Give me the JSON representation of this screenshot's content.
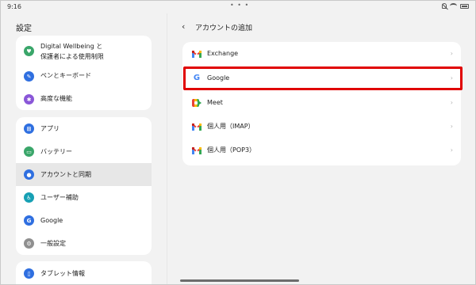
{
  "status_bar": {
    "time": "9:16",
    "center_dots": "• • •"
  },
  "left_pane": {
    "title": "設定",
    "card1": [
      {
        "label": "Digital Wellbeing と\n保護者による使用制限",
        "icon": "wellbeing-icon",
        "color": "#3aa66a"
      },
      {
        "label": "ペンとキーボード",
        "icon": "pen-icon",
        "color": "#2f6fe0"
      },
      {
        "label": "高度な機能",
        "icon": "advanced-icon",
        "color": "#8a57d8"
      }
    ],
    "card2": [
      {
        "label": "アプリ",
        "icon": "apps-icon",
        "color": "#2f6fe0"
      },
      {
        "label": "バッテリー",
        "icon": "battery-icon",
        "color": "#3aa66a"
      },
      {
        "label": "アカウントと同期",
        "icon": "account-icon",
        "color": "#2f6fe0",
        "selected": true
      },
      {
        "label": "ユーザー補助",
        "icon": "accessibility-icon",
        "color": "#17a0b4"
      },
      {
        "label": "Google",
        "icon": "google-icon",
        "color": "#2f6fe0"
      },
      {
        "label": "一般設定",
        "icon": "general-settings-icon",
        "color": "#8f8f8f"
      }
    ],
    "card3": [
      {
        "label": "タブレット情報",
        "icon": "tablet-info-icon",
        "color": "#2f6fe0"
      }
    ]
  },
  "right_pane": {
    "back_symbol": "‹",
    "title": "アカウントの追加",
    "accounts": [
      {
        "label": "Exchange",
        "icon": "gmail-icon"
      },
      {
        "label": "Google",
        "icon": "google-g-icon"
      },
      {
        "label": "Meet",
        "icon": "meet-icon"
      },
      {
        "label": "個人用（IMAP）",
        "icon": "gmail-icon"
      },
      {
        "label": "個人用（POP3）",
        "icon": "gmail-icon"
      }
    ],
    "chevron": "›",
    "highlight_color": "#e00000"
  }
}
